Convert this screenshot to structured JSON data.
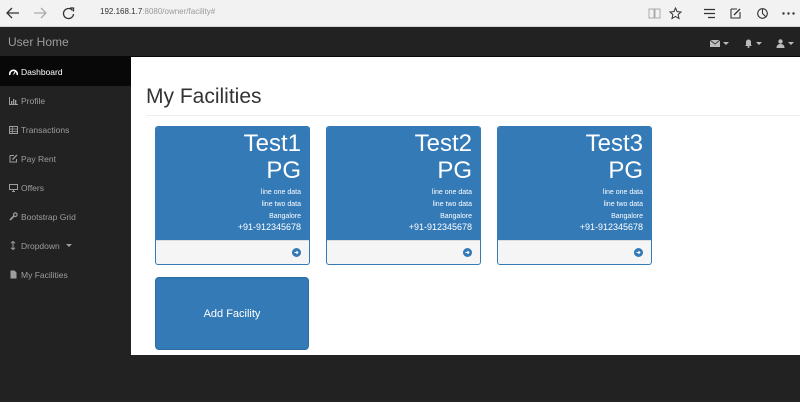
{
  "browser": {
    "url_host": "192.168.1.7",
    "url_rest": ":8080/owner/facility#"
  },
  "navbar": {
    "brand": "User Home",
    "dropdowns": [
      {
        "icon": "envelope-icon"
      },
      {
        "icon": "bell-icon"
      },
      {
        "icon": "user-icon"
      }
    ]
  },
  "sidebar": {
    "items": [
      {
        "label": "Dashboard",
        "icon": "dashboard-icon"
      },
      {
        "label": "Profile",
        "icon": "bar-chart-icon"
      },
      {
        "label": "Transactions",
        "icon": "table-icon"
      },
      {
        "label": "Pay Rent",
        "icon": "edit-icon"
      },
      {
        "label": "Offers",
        "icon": "desktop-icon"
      },
      {
        "label": "Bootstrap Grid",
        "icon": "wrench-icon"
      },
      {
        "label": "Dropdown",
        "icon": "arrows-v-icon"
      },
      {
        "label": "My Facilities",
        "icon": "file-icon"
      }
    ]
  },
  "main": {
    "title": "My Facilities",
    "cards": [
      {
        "name": "Test1",
        "type": "PG",
        "line1": "line one data",
        "line2": "line two data",
        "city": "Bangalore",
        "phone": "+91-912345678"
      },
      {
        "name": "Test2",
        "type": "PG",
        "line1": "line one data",
        "line2": "line two data",
        "city": "Bangalore",
        "phone": "+91-912345678"
      },
      {
        "name": "Test3",
        "type": "PG",
        "line1": "line one data",
        "line2": "line two data",
        "city": "Bangalore",
        "phone": "+91-912345678"
      }
    ],
    "add_label": "Add Facility"
  },
  "colors": {
    "primary": "#337ab7",
    "dark": "#222222",
    "active": "#080808"
  }
}
